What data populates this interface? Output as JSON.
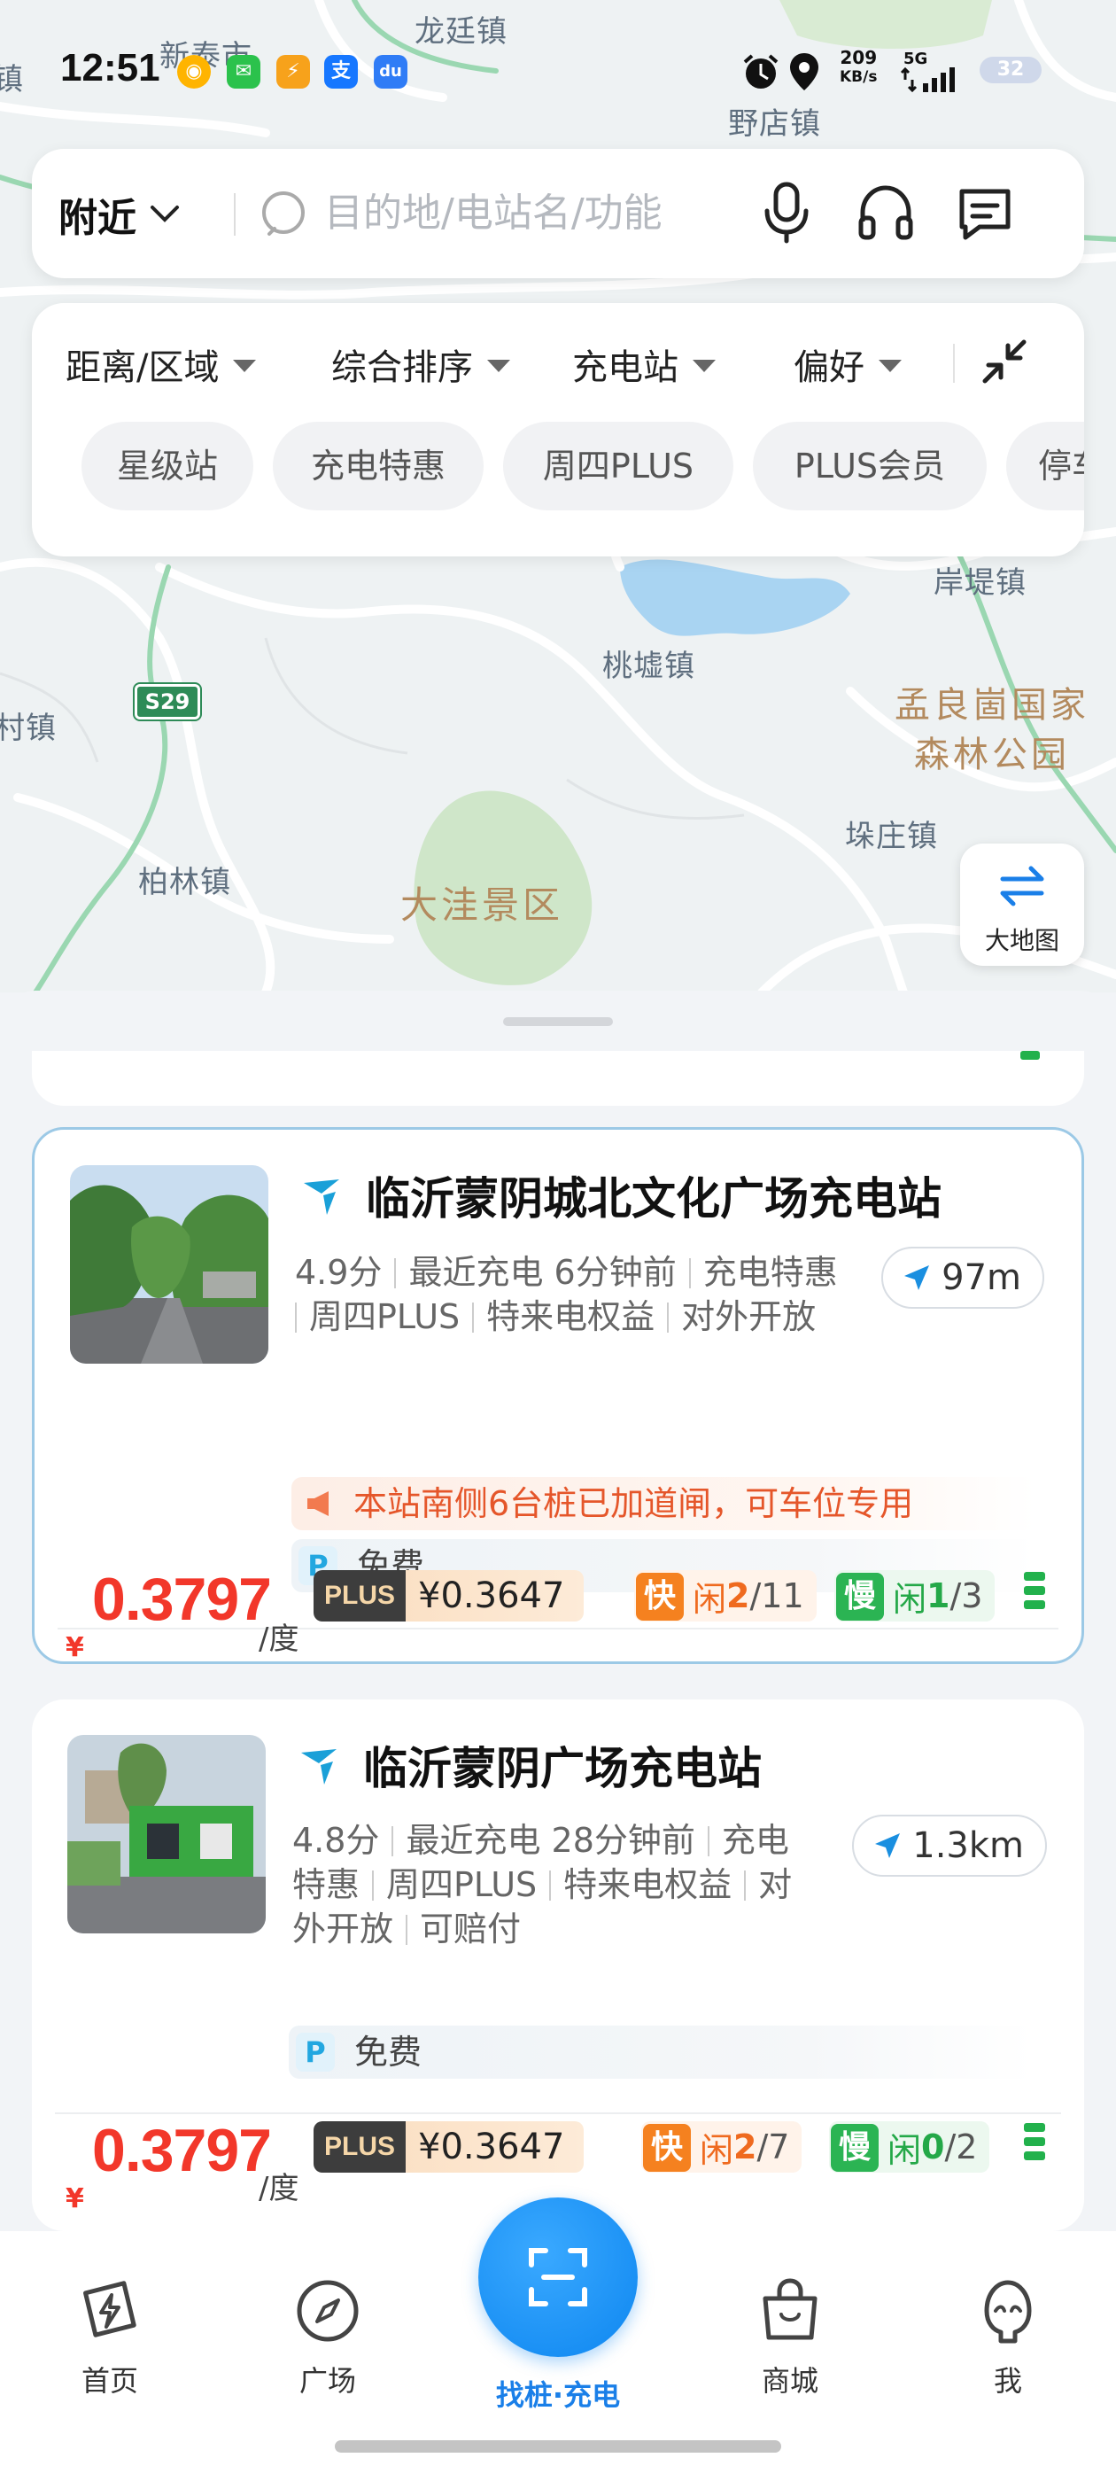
{
  "status_bar": {
    "time": "12:51",
    "net_speed_value": "209",
    "net_speed_unit": "KB/s",
    "network": "5G",
    "battery": "32"
  },
  "map_labels": {
    "l1": "新泰市",
    "l2": "龙廷镇",
    "l3": "野店镇",
    "l4": "岸堤镇",
    "l5": "桃墟镇",
    "l6": "孟良崮国家",
    "l7": "森林公园",
    "l8": "垛庄镇",
    "l9": "柏林镇",
    "l10": "大洼景区",
    "l11": "村镇",
    "l12": "镇",
    "l13": "S29"
  },
  "search": {
    "location_label": "附近",
    "placeholder": "目的地/电站名/功能"
  },
  "filters": {
    "dropdowns": [
      "距离/区域",
      "综合排序",
      "充电站",
      "偏好"
    ],
    "chips": [
      "星级站",
      "充电特惠",
      "周四PLUS",
      "PLUS会员",
      "停车"
    ]
  },
  "map_switch": {
    "label": "大地图"
  },
  "stations": [
    {
      "name": "临沂蒙阴城北文化广场充电站",
      "meta_line1": [
        "4.9分",
        "最近充电 6分钟前",
        "充电特惠"
      ],
      "meta_line2": [
        "周四PLUS",
        "特来电权益",
        "对外开放"
      ],
      "distance": "97m",
      "notice": "本站南侧6台桩已加道闸，可车位专用",
      "parking_icon": "P",
      "parking": "免费",
      "currency": "¥",
      "price": "0.3797",
      "unit": "/度",
      "plus_label": "PLUS",
      "plus_price": "¥0.3647",
      "fast_label": "快",
      "fast_free_text": "闲",
      "fast_free": "2",
      "fast_total": "/11",
      "slow_label": "慢",
      "slow_free_text": "闲",
      "slow_free": "1",
      "slow_total": "/3"
    },
    {
      "name": "临沂蒙阴广场充电站",
      "meta_line1": [
        "4.8分",
        "最近充电 28分钟前",
        "充电"
      ],
      "meta_line2": [
        "特惠",
        "周四PLUS",
        "特来电权益",
        "对"
      ],
      "meta_line3": [
        "外开放",
        "可赔付"
      ],
      "distance": "1.3km",
      "parking_icon": "P",
      "parking": "免费",
      "currency": "¥",
      "price": "0.3797",
      "unit": "/度",
      "plus_label": "PLUS",
      "plus_price": "¥0.3647",
      "fast_label": "快",
      "fast_free_text": "闲",
      "fast_free": "2",
      "fast_total": "/7",
      "slow_label": "慢",
      "slow_free_text": "闲",
      "slow_free": "0",
      "slow_total": "/2"
    }
  ],
  "bottom_nav": {
    "home": "首页",
    "plaza": "广场",
    "scan": "找桩·充电",
    "mall": "商城",
    "me": "我"
  },
  "colors": {
    "price_red": "#f2372a",
    "fast_orange": "#f5811f",
    "slow_green": "#2bb453",
    "accent_blue": "#0d86f0"
  }
}
